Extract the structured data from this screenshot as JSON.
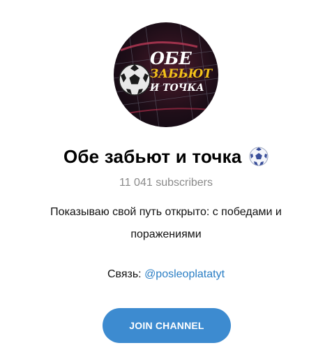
{
  "channel": {
    "avatar_icon": "soccer-ball-goal-logo",
    "logo_text_line1": "ОБЕ",
    "logo_text_line2": "ЗАБЬЮТ",
    "logo_text_line3": "И ТОЧКА",
    "title": "Обе забьют и точка",
    "title_emoji": "soccer-ball-icon",
    "subscribers": "11 041 subscribers",
    "description": "Показываю свой путь открыто: с победами и поражениями",
    "contact_label": "Связь: ",
    "contact_link": "@posleoplatatyt"
  },
  "actions": {
    "join_label": "JOIN CHANNEL"
  },
  "colors": {
    "accent": "#3d8bd0",
    "link": "#2a7ec4",
    "muted": "#8a8a8a"
  }
}
